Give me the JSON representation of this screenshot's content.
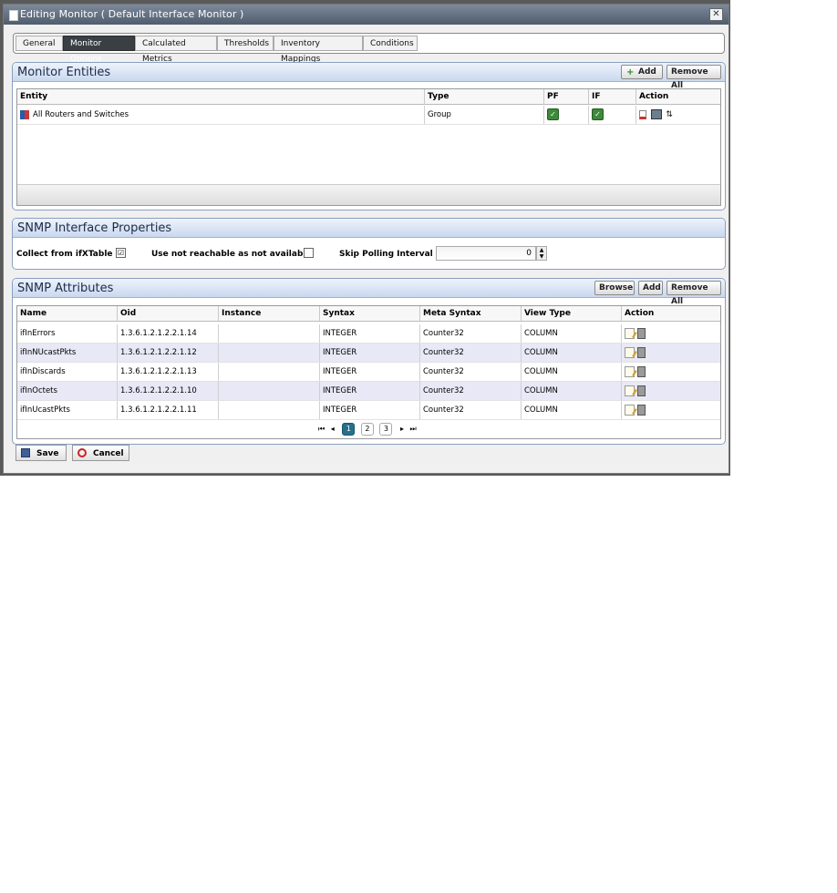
{
  "window": {
    "title": "Editing Monitor ( Default Interface Monitor )",
    "close_label": "✕"
  },
  "tabs": [
    {
      "label": "General"
    },
    {
      "label": "Monitor Options"
    },
    {
      "label": "Calculated Metrics"
    },
    {
      "label": "Thresholds"
    },
    {
      "label": "Inventory Mappings"
    },
    {
      "label": "Conditions"
    }
  ],
  "active_tab": "Monitor Options",
  "monitor_entities": {
    "title": "Monitor Entities",
    "add_label": "Add",
    "remove_all_label": "Remove All",
    "columns": [
      "Entity",
      "Type",
      "PF",
      "IF",
      "Action"
    ],
    "rows": [
      {
        "entity": "All Routers and Switches",
        "type": "Group",
        "pf": true,
        "if": true
      }
    ]
  },
  "snmp_interface": {
    "title": "SNMP Interface Properties",
    "collect_label": "Collect from ifXTable",
    "collect_checked": "☑",
    "unreachable_label": "Use not reachable as not available",
    "unreachable_checked": "",
    "skip_label": "Skip Polling Interval",
    "skip_value": "0"
  },
  "snmp_attributes": {
    "title": "SNMP Attributes",
    "browse_label": "Browse",
    "add_label": "Add",
    "remove_all_label": "Remove All",
    "columns": [
      "Name",
      "Oid",
      "Instance",
      "Syntax",
      "Meta Syntax",
      "View Type",
      "Action"
    ],
    "rows": [
      {
        "name": "ifInErrors",
        "oid": "1.3.6.1.2.1.2.2.1.14",
        "instance": "",
        "syntax": "INTEGER",
        "meta": "Counter32",
        "view": "COLUMN"
      },
      {
        "name": "ifInNUcastPkts",
        "oid": "1.3.6.1.2.1.2.2.1.12",
        "instance": "",
        "syntax": "INTEGER",
        "meta": "Counter32",
        "view": "COLUMN"
      },
      {
        "name": "ifInDiscards",
        "oid": "1.3.6.1.2.1.2.2.1.13",
        "instance": "",
        "syntax": "INTEGER",
        "meta": "Counter32",
        "view": "COLUMN"
      },
      {
        "name": "ifInOctets",
        "oid": "1.3.6.1.2.1.2.2.1.10",
        "instance": "",
        "syntax": "INTEGER",
        "meta": "Counter32",
        "view": "COLUMN"
      },
      {
        "name": "ifInUcastPkts",
        "oid": "1.3.6.1.2.1.2.2.1.11",
        "instance": "",
        "syntax": "INTEGER",
        "meta": "Counter32",
        "view": "COLUMN"
      }
    ],
    "pages": [
      "1",
      "2",
      "3"
    ],
    "current_page": "1"
  },
  "footer": {
    "save_label": "Save",
    "cancel_label": "Cancel"
  },
  "colors": {
    "active_tab": "#3a3f44",
    "panel_header": "#c9d8ef",
    "check_green": "#3d8a3a",
    "row_alt": "#e8e8f6"
  }
}
